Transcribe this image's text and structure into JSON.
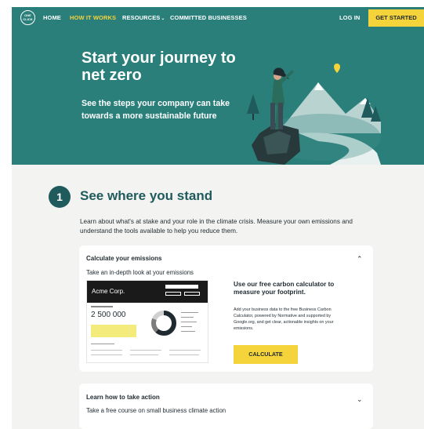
{
  "logo": {
    "text": "ONE CLICK"
  },
  "nav": {
    "items": [
      {
        "label": "HOME"
      },
      {
        "label": "HOW IT WORKS"
      },
      {
        "label": "RESOURCES"
      },
      {
        "label": "COMMITTED BUSINESSES"
      }
    ],
    "login": "LOG IN",
    "cta": "GET STARTED"
  },
  "hero": {
    "title": "Start your journey to net zero",
    "subtitle": "See the steps your company can take towards a more sustainable future"
  },
  "step1": {
    "number": "1",
    "title": "See where you stand",
    "description": "Learn about what's at stake and your role in the climate crisis. Measure your own emissions and understand the tools available to help you reduce them."
  },
  "card_emissions": {
    "title": "Calculate your emissions",
    "subtitle": "Take an in-depth look at your emissions",
    "preview": {
      "company": "Acme Corp.",
      "total": "2 500 000"
    },
    "promo_title": "Use our free carbon calculator to measure your footprint.",
    "promo_body": "Add your business data to the free Business Carbon Calculator, powered by Normative and supported by Google.org, and get clear, actionable insights on your emissions.",
    "button": "CALCULATE"
  },
  "card_action": {
    "title": "Learn how to take action",
    "subtitle": "Take a free course on small business climate action"
  },
  "colors": {
    "teal": "#2a7f7a",
    "dark_teal": "#1f5a5c",
    "yellow": "#f5d33a",
    "background": "#f3f3f1"
  }
}
